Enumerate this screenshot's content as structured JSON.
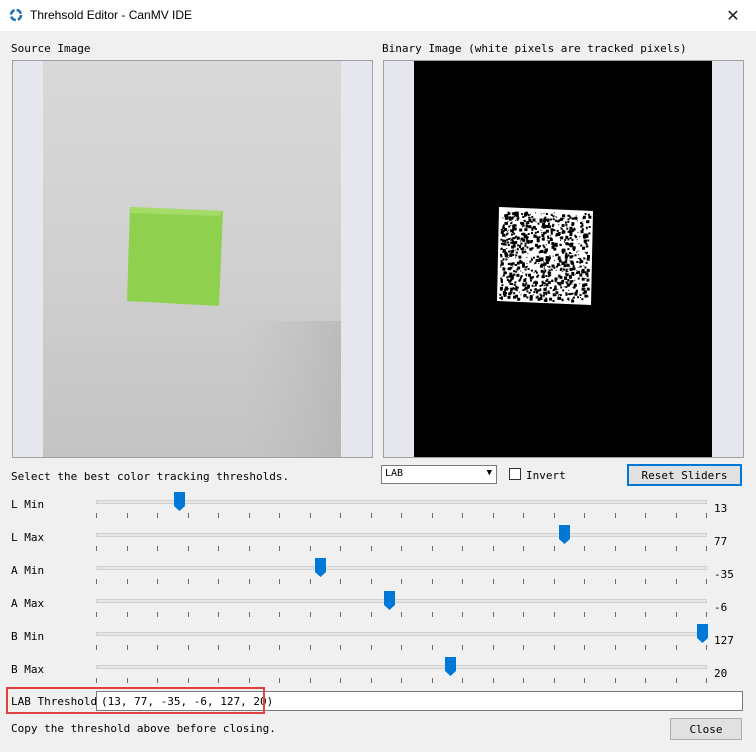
{
  "window": {
    "title": "Threhsold Editor - CanMV IDE",
    "close_icon": "close-icon"
  },
  "panes": {
    "source_label": "Source Image",
    "binary_label": "Binary Image (white pixels are tracked pixels)"
  },
  "instructions": "Select the best color tracking thresholds.",
  "colorspace": {
    "selected": "LAB"
  },
  "invert": {
    "label": "Invert",
    "checked": false
  },
  "reset_label": "Reset Sliders",
  "sliders": [
    {
      "label": "L Min",
      "value": "13"
    },
    {
      "label": "L Max",
      "value": "77"
    },
    {
      "label": "A Min",
      "value": "-35"
    },
    {
      "label": "A Max",
      "value": "-6"
    },
    {
      "label": "B Min",
      "value": "127"
    },
    {
      "label": "B Max",
      "value": "20"
    }
  ],
  "threshold": {
    "label": "LAB Threshold",
    "value": "(13, 77, -35, -6, 127, 20)"
  },
  "footer_note": "Copy the threshold above before closing.",
  "close_label": "Close",
  "colors": {
    "accent": "#0078d7",
    "highlight": "#e04040",
    "cube": "#8fd14f"
  }
}
